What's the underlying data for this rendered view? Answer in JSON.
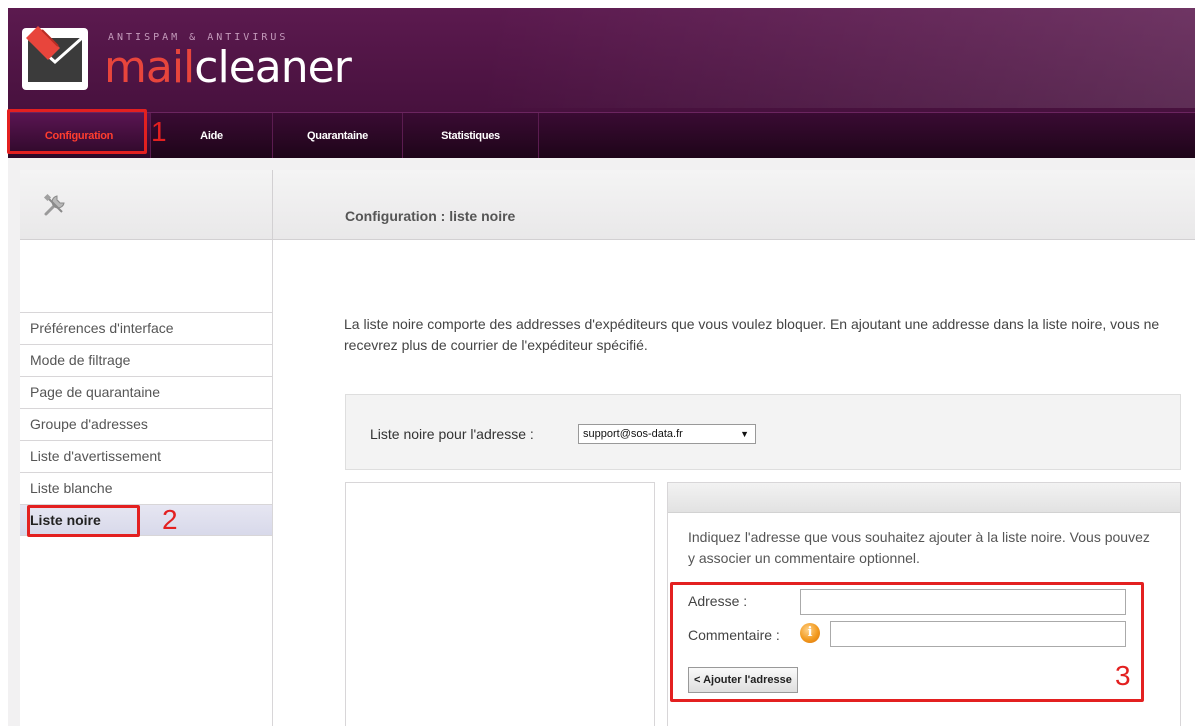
{
  "brand": {
    "tagline": "ANTISPAM & ANTIVIRUS",
    "name_part1": "mail",
    "name_part2": "cleaner",
    "logo_icon": "envelope-logo-icon"
  },
  "nav": {
    "items": [
      {
        "label": "Configuration",
        "active": true
      },
      {
        "label": "Aide",
        "active": false
      },
      {
        "label": "Quarantaine",
        "active": false
      },
      {
        "label": "Statistiques",
        "active": false
      }
    ]
  },
  "page": {
    "title": "Configuration : liste noire",
    "tools_icon": "tools-icon"
  },
  "sidebar": {
    "items": [
      {
        "label": "Préférences d'interface",
        "active": false
      },
      {
        "label": "Mode de filtrage",
        "active": false
      },
      {
        "label": "Page de quarantaine",
        "active": false
      },
      {
        "label": "Groupe d'adresses",
        "active": false
      },
      {
        "label": "Liste d'avertissement",
        "active": false
      },
      {
        "label": "Liste blanche",
        "active": false
      },
      {
        "label": "Liste noire",
        "active": true
      }
    ]
  },
  "intro": "La liste noire comporte des addresses d'expéditeurs que vous voulez bloquer. En ajoutant une addresse dans la liste noire, vous ne recevrez plus de courrier de l'expéditeur spécifié.",
  "address_selector": {
    "label": "Liste noire pour l'adresse :",
    "selected": "support@sos-data.fr",
    "arrow": "▼"
  },
  "add_form": {
    "help": "Indiquez l'adresse que vous souhaitez ajouter à la liste noire. Vous pouvez y associer un commentaire optionnel.",
    "address_label": "Adresse :",
    "address_value": "",
    "comment_label": "Commentaire :",
    "comment_value": "",
    "info_icon_glyph": "i",
    "submit_label": "< Ajouter l'adresse"
  },
  "annotations": {
    "step1": "1",
    "step2": "2",
    "step3": "3",
    "color": "#e32020"
  },
  "colors": {
    "header": "#4a1240",
    "active_nav": "#ff3d2e",
    "brand_accent": "#e8453c"
  }
}
